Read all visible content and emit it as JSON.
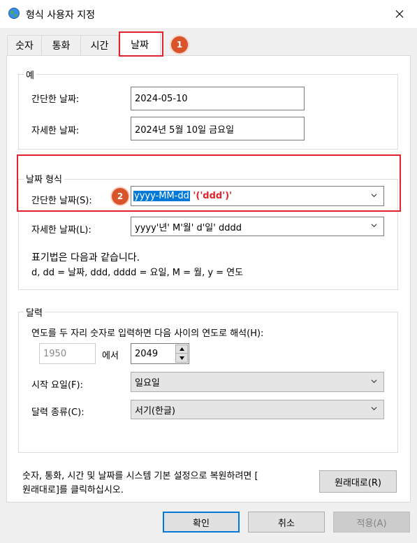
{
  "window": {
    "title": "형식 사용자 지정"
  },
  "tabs": [
    {
      "label": "숫자"
    },
    {
      "label": "통화"
    },
    {
      "label": "시간"
    },
    {
      "label": "날짜"
    }
  ],
  "annotations": {
    "badge1": "1",
    "badge2": "2"
  },
  "example": {
    "group_title": "예",
    "short_label": "간단한 날짜:",
    "short_value": "2024-05-10",
    "long_label": "자세한 날짜:",
    "long_value": "2024년 5월 10일 금요일"
  },
  "date_format": {
    "group_title": "날짜 형식",
    "short_label": "간단한 날짜(S):",
    "short_value_selected": "yyyy-MM-dd",
    "short_value_appended": " '('ddd')'",
    "long_label": "자세한 날짜(L):",
    "long_value": "yyyy'년' M'월' d'일' dddd",
    "notation_line1": "표기법은 다음과 같습니다.",
    "notation_line2": "d, dd = 날짜,  ddd, dddd = 요일,  M = 월,  y = 연도"
  },
  "calendar": {
    "group_title": "달력",
    "two_digit_label": "연도를 두 자리 숫자로 입력하면 다음 사이의 연도로 해석(H):",
    "from_year": "1950",
    "between_label": "에서",
    "to_year": "2049",
    "first_day_label": "시작 요일(F):",
    "first_day_value": "일요일",
    "calendar_type_label": "달력 종류(C):",
    "calendar_type_value": "서기(한글)"
  },
  "reset": {
    "text_line1": "숫자, 통화, 시간 및 날짜를 시스템 기본 설정으로 복원하려면 [",
    "text_line2": "원래대로]를 클릭하십시오.",
    "button": "원래대로(R)"
  },
  "footer": {
    "ok": "확인",
    "cancel": "취소",
    "apply": "적용(A)"
  },
  "colors": {
    "highlight_red": "#e0232d",
    "selection_blue": "#0078d7",
    "badge_orange": "#d9542a"
  }
}
